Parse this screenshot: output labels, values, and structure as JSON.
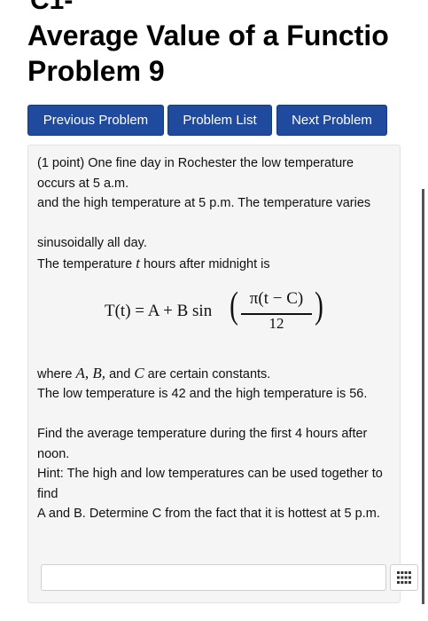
{
  "header": {
    "clipped_text": "C1-",
    "title": "Average Value of a Functio",
    "problem_label": "Problem 9"
  },
  "nav": {
    "previous_label": "Previous Problem",
    "list_label": "Problem List",
    "next_label": "Next Problem"
  },
  "problem": {
    "line1": "(1 point) One fine day in Rochester the low temperature occurs at 5 a.m.",
    "line2": "and the high temperature at 5 p.m. The temperature varies",
    "line3": "sinusoidally all day.",
    "line4_prefix": "The temperature ",
    "line4_var": "t",
    "line4_suffix": " hours after midnight is",
    "formula": {
      "lhs": "T(t) = A + B sin",
      "numerator": "π(t − C)",
      "denominator": "12"
    },
    "constants_prefix": "where ",
    "constants_vars": "A, B,",
    "constants_and": " and ",
    "constants_c": "C",
    "constants_suffix": " are certain constants.",
    "line6": "The low temperature is 42 and the high temperature is 56.",
    "line7": "Find the average temperature during the first 4 hours after noon.",
    "line8": "Hint: The high and low temperatures can be used together to find",
    "line9": "A and B. Determine C from the fact that it is hottest at 5 p.m."
  },
  "answer": {
    "value": "",
    "placeholder": ""
  },
  "colors": {
    "button_bg": "#1f4a9e",
    "panel_bg": "#f5f5f5"
  },
  "icons": {
    "keypad": "keypad-icon"
  }
}
